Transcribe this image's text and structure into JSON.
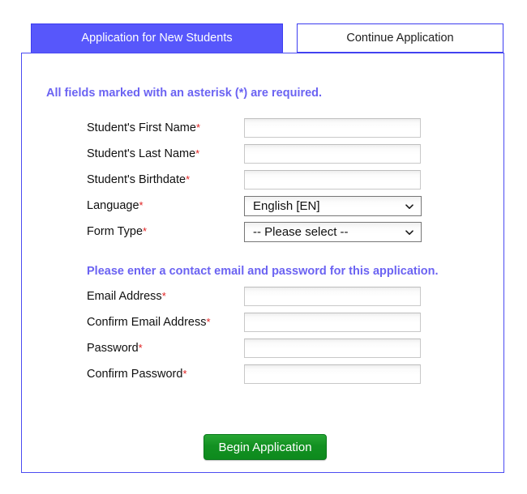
{
  "tabs": [
    {
      "id": "new-students",
      "label": "Application for New Students",
      "active": true
    },
    {
      "id": "continue",
      "label": "Continue Application",
      "active": false
    }
  ],
  "notices": {
    "required": "All fields marked with an asterisk (*) are required.",
    "contact": "Please enter a contact email and password for this application."
  },
  "required_marker": "*",
  "fields": [
    {
      "id": "first-name",
      "label": "Student's First Name",
      "type": "text",
      "value": "",
      "placeholder": ""
    },
    {
      "id": "last-name",
      "label": "Student's Last Name",
      "type": "text",
      "value": "",
      "placeholder": ""
    },
    {
      "id": "birthdate",
      "label": "Student's Birthdate",
      "type": "text",
      "value": "",
      "placeholder": ""
    },
    {
      "id": "language",
      "label": "Language",
      "type": "select",
      "value": "English [EN]"
    },
    {
      "id": "form-type",
      "label": "Form Type",
      "type": "select",
      "value": "-- Please select --"
    },
    {
      "id": "email",
      "label": "Email Address",
      "type": "text",
      "value": "",
      "placeholder": ""
    },
    {
      "id": "confirm-email",
      "label": "Confirm Email Address",
      "type": "text",
      "value": "",
      "placeholder": ""
    },
    {
      "id": "password",
      "label": "Password",
      "type": "password",
      "value": "",
      "placeholder": ""
    },
    {
      "id": "confirm-password",
      "label": "Confirm Password",
      "type": "password",
      "value": "",
      "placeholder": ""
    }
  ],
  "submit": {
    "label": "Begin Application"
  },
  "icons": {
    "chevron": "chevron-down-icon"
  },
  "colors": {
    "tab_active_bg": "#5757fb",
    "panel_border": "#4b4bf2",
    "notice_text": "#6b63f2",
    "required_asterisk": "#e02020",
    "submit_bg": "#13901f",
    "submit_text": "#ffffff"
  }
}
